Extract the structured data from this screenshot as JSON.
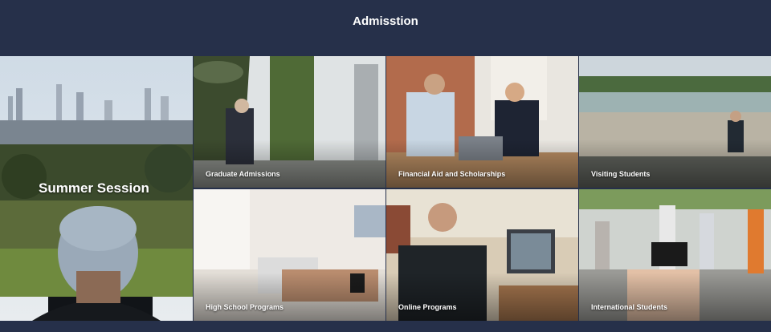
{
  "header": {
    "title": "Admisstion"
  },
  "tiles": [
    {
      "label": "Summer Session"
    },
    {
      "label": "Graduate Admissions"
    },
    {
      "label": "Financial Aid and Scholarships"
    },
    {
      "label": "Visiting Students"
    },
    {
      "label": "High School Programs"
    },
    {
      "label": "Online Programs"
    },
    {
      "label": "International Students"
    }
  ],
  "colors": {
    "header_bg": "#26304a",
    "text": "#ffffff"
  }
}
